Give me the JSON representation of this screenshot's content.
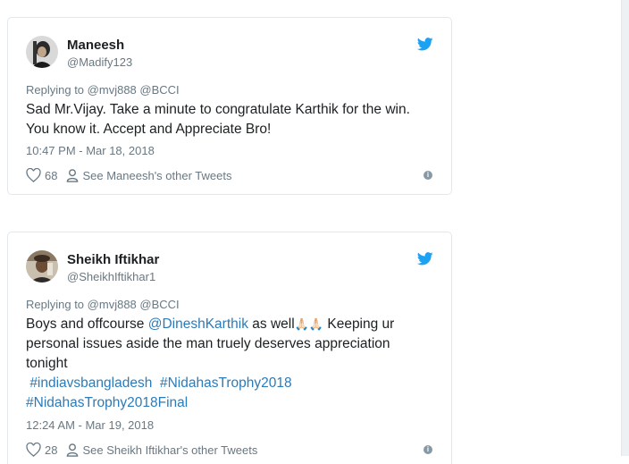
{
  "tweets": [
    {
      "name": "Maneesh",
      "handle": "@Madify123",
      "reply_prefix": "Replying to",
      "reply_to": [
        "@mvj888",
        "@BCCI"
      ],
      "text_lines": [
        "Sad Mr.Vijay. Take a minute to congratulate Karthik for the win.",
        "You know it. Accept and Appreciate Bro!"
      ],
      "timestamp": "10:47 PM - Mar 18, 2018",
      "likes": "68",
      "other_tweets": "See Maneesh's other Tweets"
    },
    {
      "name": "Sheikh Iftikhar",
      "handle": "@SheikhIftikhar1",
      "reply_prefix": "Replying to",
      "reply_to": [
        "@mvj888",
        "@BCCI"
      ],
      "text_part1": "Boys and offcourse",
      "mention": "@DineshKarthik",
      "text_part2": "as well",
      "emoji": "🙏🏻🙏🏻",
      "text_part3": "Keeping ur",
      "text_line2": "personal issues aside the man truely deserves appreciation",
      "text_line3": "tonight",
      "hashtags": [
        "#indiavsbangladesh",
        "#NidahasTrophy2018",
        "#NidahasTrophy2018Final"
      ],
      "timestamp": "12:24 AM - Mar 19, 2018",
      "likes": "28",
      "other_tweets": "See Sheikh Iftikhar's other Tweets"
    }
  ],
  "colors": {
    "twitter_blue": "#1da1f2",
    "link": "#2b7bb9",
    "muted": "#697882",
    "border": "#e1e8ed"
  },
  "icons": [
    "avatar",
    "twitter-bird-icon",
    "heart-icon",
    "person-icon",
    "info-icon"
  ]
}
